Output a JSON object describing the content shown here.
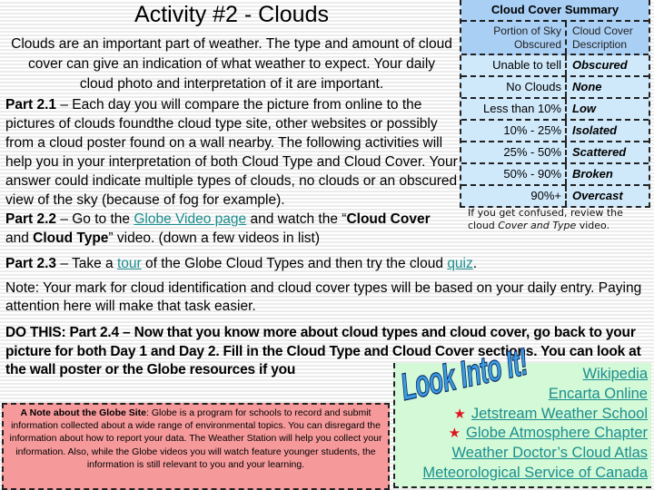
{
  "page": {
    "title": "Activity #2 - Clouds",
    "intro_lines": [
      "Clouds are an important part of weather. The type and amount of cloud",
      "cover can give an indication of what weather to expect. Your daily",
      "cloud photo and interpretation of it are important."
    ]
  },
  "part21": {
    "label": "Part 2.1",
    "text": " – Each day you will compare the picture from online to the pictures of clouds foundthe cloud type site, other websites or possibly from a cloud poster found on a wall nearby. The following activities will help you in your interpretation of both Cloud Type and Cloud Cover. Your answer could indicate multiple types of clouds, no clouds or an obscured view of the sky (because of fog for example)."
  },
  "summary": {
    "title": "Cloud Cover Summary",
    "col1_header": [
      "Portion of Sky",
      "Obscured"
    ],
    "col2_header": [
      "Cloud Cover",
      "Description"
    ],
    "rows": [
      {
        "portion": "Unable to tell",
        "description": "Obscured"
      },
      {
        "portion": "No Clouds",
        "description": "None"
      },
      {
        "portion": "Less than 10%",
        "description": "Low"
      },
      {
        "portion": "10% - 25%",
        "description": "Isolated"
      },
      {
        "portion": "25% - 50%",
        "description": "Scattered"
      },
      {
        "portion": "50% - 90%",
        "description": "Broken"
      },
      {
        "portion": "90%+",
        "description": "Overcast"
      }
    ],
    "confused_pre": "If you get confused, review the cloud ",
    "confused_italic": "Cover and Type",
    "confused_post": " video."
  },
  "part22": {
    "label": "Part 2.2",
    "pre": " – Go to the ",
    "link": "Globe Video page",
    "mid": " and watch the “",
    "bold1": "Cloud Cover",
    "mid2": " and ",
    "bold2": "Cloud Type",
    "post": "” video. (down a few videos in list)"
  },
  "part23": {
    "label": "Part 2.3",
    "pre": " – Take a ",
    "link1": "tour",
    "mid": " of the Globe Cloud Types and then try the cloud ",
    "link2": "quiz",
    "post": "."
  },
  "note": {
    "text": "Note: Your mark for cloud identification and cloud cover types will be based on your daily entry. Paying attention here will make that task easier."
  },
  "dothis": {
    "text": "DO THIS:  Part 2.4 – Now that you know more about cloud types and cloud cover, go back to your picture for both Day 1 and Day 2. Fill in the Cloud Type and Cloud Cover sections. You can look at the wall poster or the Globe resources if you"
  },
  "globe_note": {
    "bold": "A Note about the Globe Site",
    "text": ": Globe is a program for schools to record and submit information collected about a wide range of environmental topics. You can disregard the information about how to report your data. The Weather Station will help you collect your information. Also, while the Globe videos you will watch feature younger students, the information is still relevant to you and your learning."
  },
  "look_into_it": {
    "title": "Look Into It!",
    "links": [
      {
        "label": "Wikipedia",
        "starred": false
      },
      {
        "label": "Encarta Online",
        "starred": false
      },
      {
        "label": "Jetstream Weather School",
        "starred": true
      },
      {
        "label": "Globe Atmosphere Chapter",
        "starred": true
      },
      {
        "label": "Weather Doctor’s Cloud Atlas",
        "starred": false
      },
      {
        "label": "Meteorological Service of Canada",
        "starred": false
      }
    ],
    "star_glyph": "★"
  },
  "colors": {
    "link": "#1b8e8e",
    "summary_header_bg": "#a9cff5",
    "summary_body_bg": "#cfe9fb",
    "globe_note_bg": "#f6999a",
    "look_into_bg": "#d3f9d7",
    "star": "#e0141e"
  }
}
